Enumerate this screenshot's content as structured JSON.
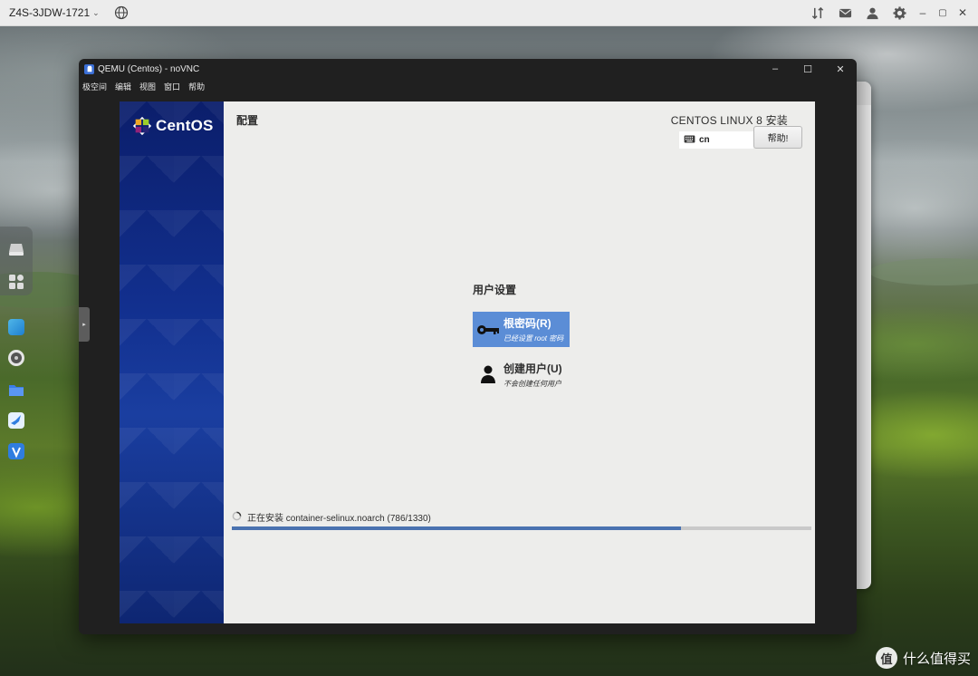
{
  "topbar": {
    "host": "Z4S-3JDW-1721",
    "icons": [
      "globe-icon",
      "sort-icon",
      "mail-icon",
      "user-icon",
      "gear-icon",
      "minimize-icon",
      "maximize-icon",
      "close-icon"
    ]
  },
  "dock": {
    "icons": [
      "drive-icon",
      "apps-grid-icon",
      "photo-app-icon",
      "disk-app-icon",
      "folder-icon",
      "bird-app-icon",
      "vpn-app-icon"
    ]
  },
  "vnc": {
    "title": "QEMU (Centos) - noVNC",
    "menu": [
      "极空间",
      "编辑",
      "视图",
      "窗口",
      "帮助"
    ],
    "controls": {
      "minimize": "–",
      "maximize": "☐",
      "close": "✕"
    }
  },
  "installer": {
    "logo_text": "CentOS",
    "page_title": "配置",
    "product_title": "CENTOS LINUX 8 安装",
    "keyboard_layout": "cn",
    "help_button": "帮助!",
    "section_title": "用户设置",
    "spokes": [
      {
        "name": "根密码(R)",
        "status": "已经设置 root 密码"
      },
      {
        "name": "创建用户(U)",
        "status": "不会创建任何用户"
      }
    ],
    "progress": {
      "text": "正在安装 container-selinux.noarch (786/1330)",
      "fraction": 0.7746
    }
  },
  "watermark": {
    "text": "什么值得买",
    "badge": "值"
  },
  "colors": {
    "accent": "#5b8dd6",
    "progress": "#4a72b0",
    "sidebar": "#12308f"
  }
}
